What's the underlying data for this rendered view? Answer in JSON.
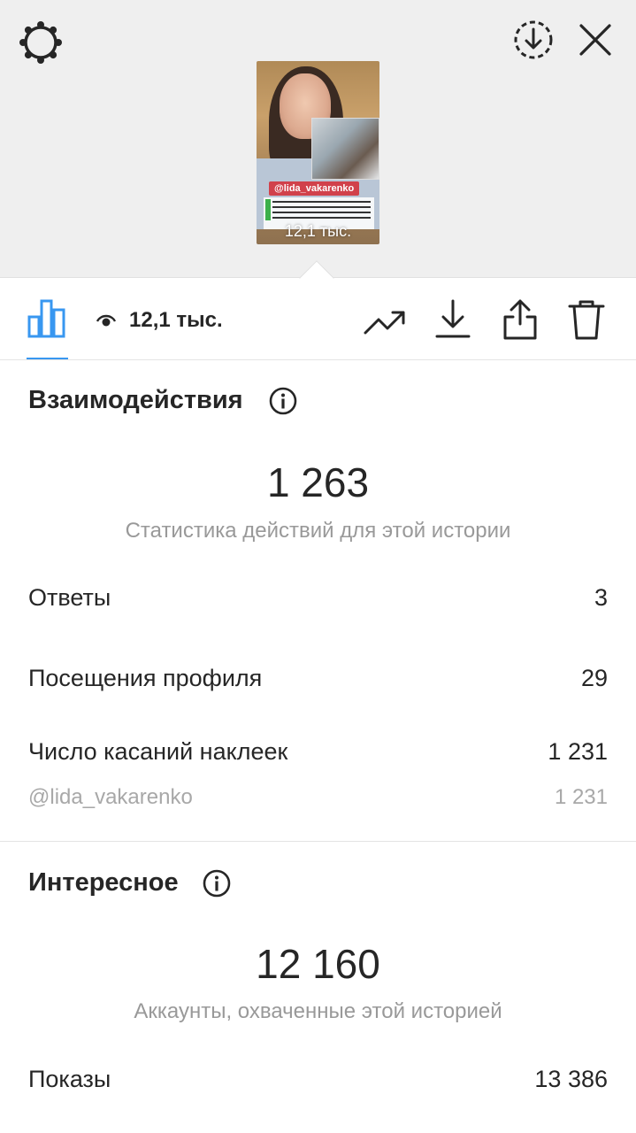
{
  "header": {
    "icons": {
      "settings": "gear-icon",
      "save": "download-circle-icon",
      "close": "close-icon"
    }
  },
  "story": {
    "username_tag": "@lida_vakarenko",
    "views_overlay": "12,1 тыс."
  },
  "toolbar": {
    "views": "12,1 тыс.",
    "accent_color": "#3897f0",
    "icons": [
      "bar-chart-icon",
      "eye-icon",
      "trend-icon",
      "download-icon",
      "share-icon",
      "trash-icon"
    ]
  },
  "interactions": {
    "title": "Взаимодействия",
    "total": "1 263",
    "caption": "Статистика действий для этой истории",
    "rows": [
      {
        "label": "Ответы",
        "value": "3"
      },
      {
        "label": "Посещения профиля",
        "value": "29"
      },
      {
        "label": "Число касаний наклеек",
        "value": "1 231"
      }
    ],
    "sub_row": {
      "label": "@lida_vakarenko",
      "value": "1 231"
    }
  },
  "discovery": {
    "title": "Интересное",
    "total": "12 160",
    "caption": "Аккаунты, охваченные этой историей",
    "rows": [
      {
        "label": "Показы",
        "value": "13 386"
      }
    ]
  }
}
